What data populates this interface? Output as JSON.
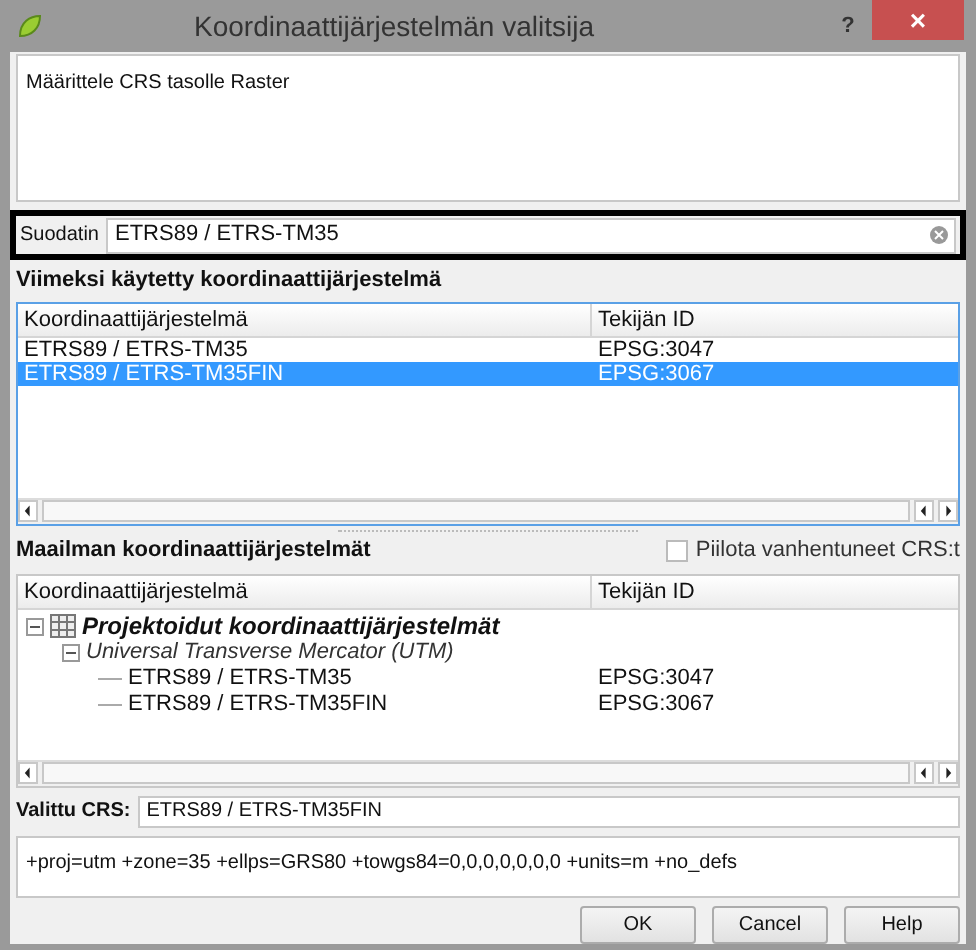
{
  "window": {
    "title": "Koordinaattijärjestelmän valitsija",
    "help": "?",
    "close": "×"
  },
  "description": "Määrittele CRS tasolle Raster",
  "filter": {
    "label": "Suodatin",
    "value": "ETRS89 / ETRS-TM35"
  },
  "recent": {
    "heading": "Viimeksi käytetty koordinaattijärjestelmä",
    "columns": [
      "Koordinaattijärjestelmä",
      "Tekijän ID"
    ],
    "rows": [
      {
        "name": "ETRS89 / ETRS-TM35",
        "id": "EPSG:3047",
        "selected": false
      },
      {
        "name": "ETRS89 / ETRS-TM35FIN",
        "id": "EPSG:3067",
        "selected": true
      }
    ]
  },
  "world": {
    "heading": "Maailman koordinaattijärjestelmät",
    "hide_deprecated": {
      "label": "Piilota vanhentuneet CRS:t",
      "checked": false
    },
    "columns": [
      "Koordinaattijärjestelmä",
      "Tekijän ID"
    ],
    "tree": [
      {
        "name": "Projektoidut koordinaattijärjestelmät",
        "kind": "category",
        "expanded": true,
        "children": [
          {
            "name": "Universal Transverse Mercator (UTM)",
            "kind": "group",
            "expanded": true,
            "children": [
              {
                "name": "ETRS89 / ETRS-TM35",
                "kind": "crs",
                "id": "EPSG:3047"
              },
              {
                "name": "ETRS89 / ETRS-TM35FIN",
                "kind": "crs",
                "id": "EPSG:3067"
              }
            ]
          }
        ]
      }
    ]
  },
  "selected_crs": {
    "label": "Valittu CRS:",
    "value": "ETRS89 / ETRS-TM35FIN"
  },
  "proj4": "+proj=utm +zone=35 +ellps=GRS80 +towgs84=0,0,0,0,0,0,0 +units=m +no_defs",
  "buttons": [
    "OK",
    "Cancel",
    "Help"
  ]
}
